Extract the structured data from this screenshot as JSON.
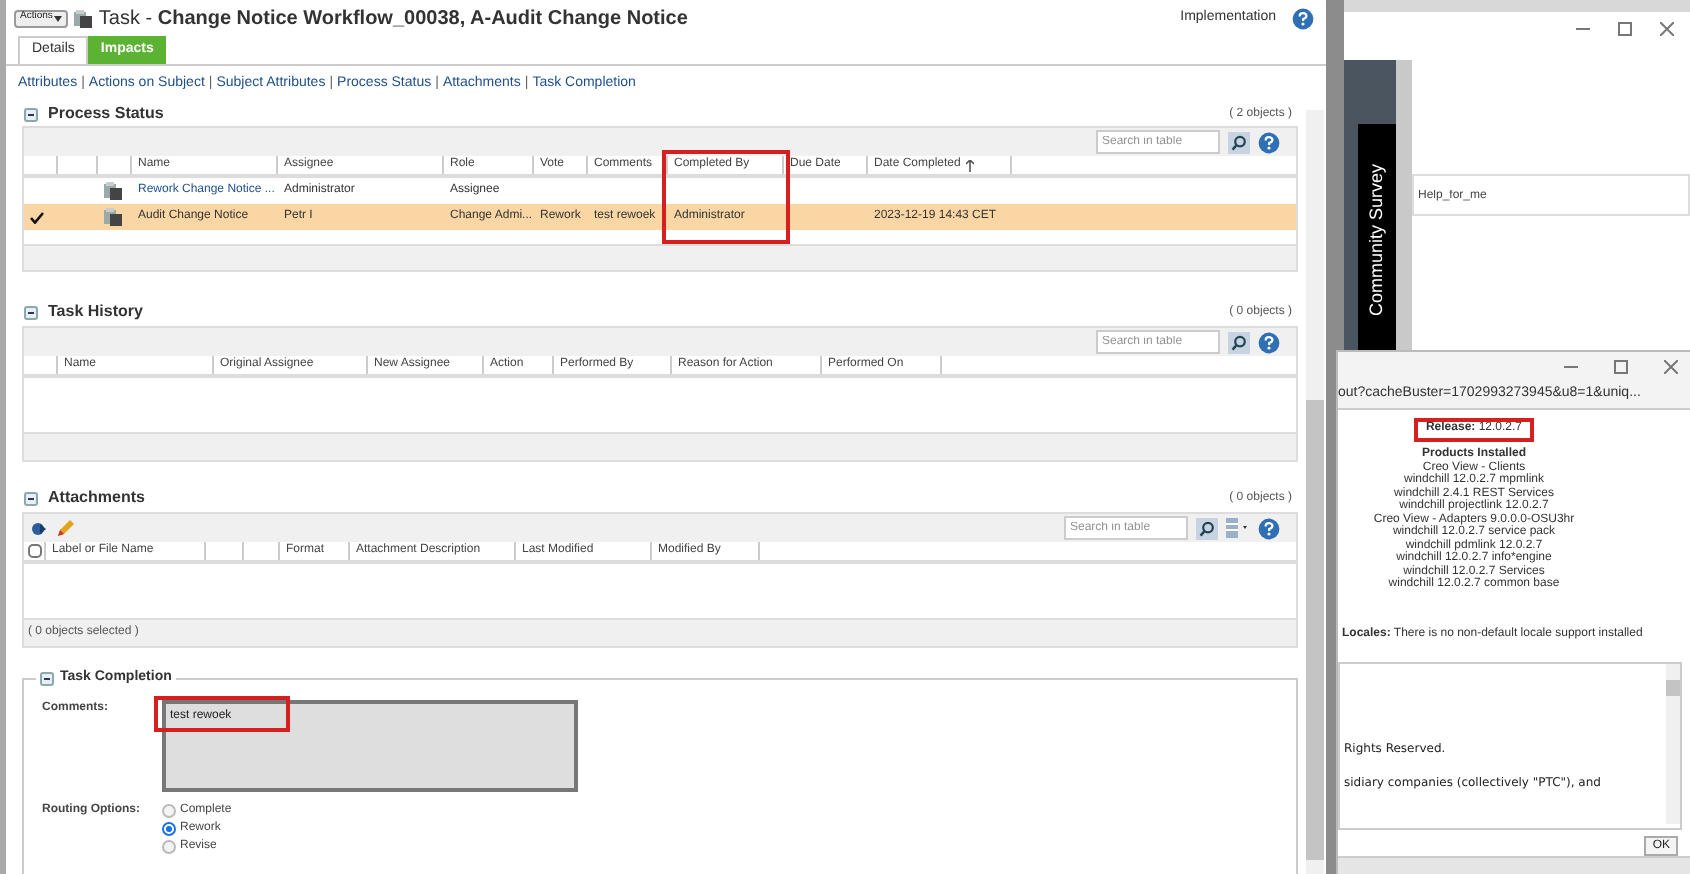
{
  "header": {
    "actions": "Actions",
    "title_prefix": "Task -",
    "title": "Change Notice Workflow_00038, A-Audit Change Notice",
    "context": "Implementation"
  },
  "tabs": [
    {
      "label": "Details",
      "selected": true
    },
    {
      "label": "Impacts",
      "selected": false
    }
  ],
  "link_separator": "|",
  "section_links": [
    "Attributes",
    "Actions on Subject",
    "Subject Attributes",
    "Process Status",
    "Attachments",
    "Task Completion"
  ],
  "process_status": {
    "title": "Process Status",
    "count": "( 2 objects )",
    "search_placeholder": "Search in table",
    "columns": [
      {
        "highlighted": false
      },
      {
        "highlighted": false
      },
      {
        "highlighted": false
      },
      {
        "label": "Name",
        "highlighted": false
      },
      {
        "label": "Assignee",
        "highlighted": false
      },
      {
        "label": "Role",
        "highlighted": false
      },
      {
        "label": "Vote",
        "highlighted": false
      },
      {
        "label": "Comments",
        "highlighted": false
      },
      {
        "label": "Completed By",
        "highlighted": true
      },
      {
        "label": "Due Date",
        "highlighted": false
      },
      {
        "label": "Date Completed",
        "highlighted": false
      }
    ],
    "rows": [
      {
        "selected": false,
        "name": "Rework Change Notice ...",
        "assignee": "Administrator",
        "role": "Assignee",
        "vote": "",
        "comments": "",
        "completed_by": "",
        "due_date": "",
        "date_completed": ""
      },
      {
        "selected": true,
        "name": "Audit Change Notice",
        "assignee": "Petr I",
        "role": "Change Admi...",
        "vote": "Rework",
        "comments": "test rewoek",
        "completed_by": "Administrator",
        "due_date": "",
        "date_completed": "2023-12-19 14:43 CET"
      }
    ]
  },
  "task_history": {
    "title": "Task History",
    "count": "( 0 objects )",
    "search_placeholder": "Search in table",
    "columns": [
      null,
      "Name",
      "Original Assignee",
      "New Assignee",
      "Action",
      "Performed By",
      "Reason for Action",
      "Performed On"
    ]
  },
  "attachments": {
    "title": "Attachments",
    "count": "( 0 objects )",
    "search_placeholder": "Search in table",
    "select_all_checked": false,
    "columns": [
      "Label or File Name",
      null,
      null,
      "Format",
      "Attachment Description",
      "Last Modified",
      "Modified By"
    ],
    "footer": "( 0 objects selected )"
  },
  "task_completion": {
    "title": "Task Completion",
    "comments_label": "Comments:",
    "comments": "test rewoek",
    "comments_highlighted": true,
    "routing_label": "Routing Options:",
    "options": [
      {
        "label": "Complete",
        "selected": false
      },
      {
        "label": "Rework",
        "selected": true
      },
      {
        "label": "Revise",
        "selected": false
      }
    ]
  },
  "back_window": {
    "banner": "Community Survey",
    "field_value": "Help_for_me"
  },
  "about_window": {
    "url": "out?cacheBuster=1702993273945&u8=1&uniq...",
    "release_label": "Release:",
    "release": "12.0.2.7",
    "release_highlighted": true,
    "products_title": "Products Installed",
    "products": [
      "Creo View - Clients",
      "windchill 12.0.2.7 mpmlink",
      "windchill 2.4.1 REST Services",
      "windchill projectlink 12.0.2.7",
      "Creo View - Adapters 9.0.0.0-OSU3hr",
      "windchill 12.0.2.7 service pack",
      "windchill pdmlink 12.0.2.7",
      "windchill 12.0.2.7 info*engine",
      "windchill 12.0.2.7 Services",
      "windchill 12.0.2.7 common base"
    ],
    "locales_label": "Locales:",
    "locales": "There is no non-default locale support installed",
    "license_lines": [
      "Rights Reserved.",
      "sidiary companies (collectively \"PTC\"), and"
    ],
    "ok": "OK"
  }
}
